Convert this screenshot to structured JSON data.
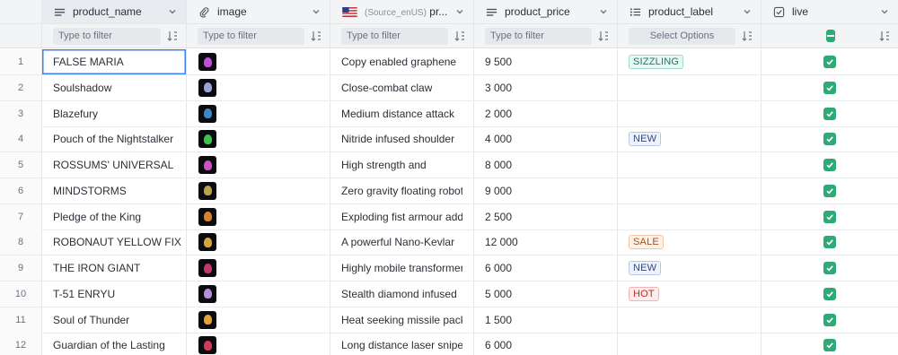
{
  "columns": {
    "name": "product_name",
    "image": "image",
    "desc_prefix": "(Source_enUS)",
    "desc_suffix": "pr...",
    "price": "product_price",
    "label": "product_label",
    "live": "live"
  },
  "filters": {
    "name": "Type to filter",
    "image": "Type to filter",
    "desc": "Type to filter",
    "price": "Type to filter",
    "label": "Select Options"
  },
  "rows": [
    {
      "idx": "1",
      "name": "FALSE MARIA",
      "desc": "Copy enabled graphene",
      "price": "9 500",
      "label": "SIZZLING",
      "thumb": "#c04dd6"
    },
    {
      "idx": "2",
      "name": "Soulshadow",
      "desc": "Close-combat claw",
      "price": "3 000",
      "label": "",
      "thumb": "#9aa4d8"
    },
    {
      "idx": "3",
      "name": "Blazefury",
      "desc": "Medium distance attack",
      "price": "2 000",
      "label": "",
      "thumb": "#3f86c6"
    },
    {
      "idx": "4",
      "name": "Pouch of the Nightstalker",
      "desc": "Nitride infused shoulder",
      "price": "4 000",
      "label": "NEW",
      "thumb": "#3ec24a"
    },
    {
      "idx": "5",
      "name": "ROSSUMS' UNIVERSAL",
      "desc": "High strength and",
      "price": "8 000",
      "label": "",
      "thumb": "#cf4fc8"
    },
    {
      "idx": "6",
      "name": "MINDSTORMS",
      "desc": "Zero gravity floating robot",
      "price": "9 000",
      "label": "",
      "thumb": "#b8a24a"
    },
    {
      "idx": "7",
      "name": "Pledge of the King",
      "desc": "Exploding fist armour add-",
      "price": "2 500",
      "label": "",
      "thumb": "#d9822e"
    },
    {
      "idx": "8",
      "name": "ROBONAUT YELLOW FIX",
      "desc": "A powerful Nano-Kevlar",
      "price": "12 000",
      "label": "SALE",
      "thumb": "#d6a63a"
    },
    {
      "idx": "9",
      "name": "THE IRON GIANT",
      "desc": "Highly mobile transformer",
      "price": "6 000",
      "label": "NEW",
      "thumb": "#c2386a"
    },
    {
      "idx": "10",
      "name": "T-51 ENRYU",
      "desc": "Stealth diamond infused",
      "price": "5 000",
      "label": "HOT",
      "thumb": "#b58fd8"
    },
    {
      "idx": "11",
      "name": "Soul of Thunder",
      "desc": "Heat seeking missile pack",
      "price": "1 500",
      "label": "",
      "thumb": "#e0a23a"
    },
    {
      "idx": "12",
      "name": "Guardian of the Lasting",
      "desc": "Long distance laser sniper",
      "price": "6 000",
      "label": "",
      "thumb": "#d23a5a"
    }
  ],
  "label_styles": {
    "SIZZLING": {
      "bg": "#e8f7f3",
      "border": "#9fd8c8",
      "color": "#1f7a62"
    },
    "NEW": {
      "bg": "#eef2fb",
      "border": "#b8c6e6",
      "color": "#2d4a87"
    },
    "SALE": {
      "bg": "#fdf1e8",
      "border": "#f0c6a6",
      "color": "#a4531d"
    },
    "HOT": {
      "bg": "#fdeceb",
      "border": "#f2b4b0",
      "color": "#b3322a"
    }
  },
  "icons": {
    "name": "list-lines-icon",
    "image": "paperclip-icon",
    "desc": "us-flag-icon",
    "price": "list-lines-icon",
    "label": "bullet-list-icon",
    "live": "checkbox-icon"
  },
  "colors": {
    "check_green": "#2eaa76",
    "selection_blue": "#3b82f6"
  }
}
